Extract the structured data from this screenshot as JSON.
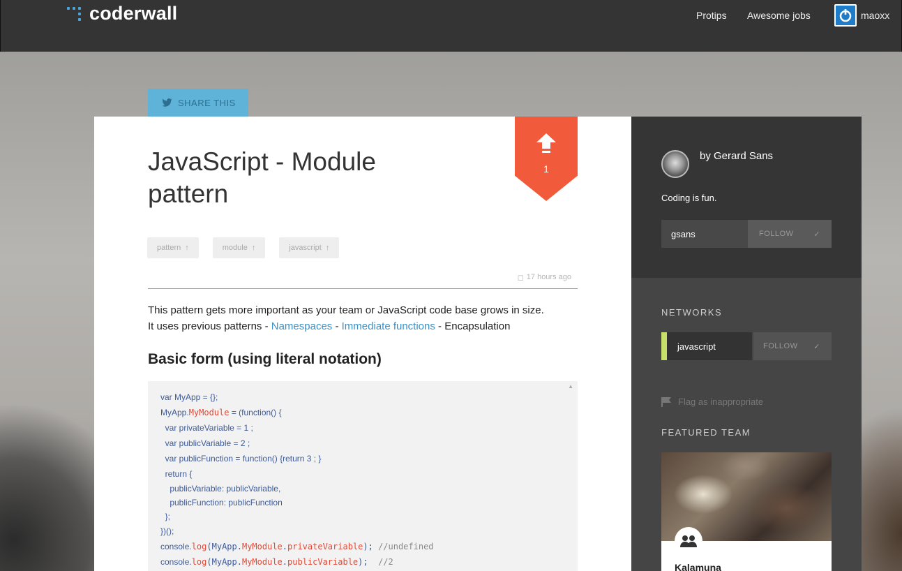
{
  "nav": {
    "logo_text": "coderwall",
    "links": [
      "Protips",
      "Awesome jobs"
    ],
    "username": "maoxx"
  },
  "share": {
    "label": "SHARE THIS"
  },
  "article": {
    "title": "JavaScript - Module pattern",
    "upvotes": "1",
    "tags": [
      "pattern",
      "module",
      "javascript"
    ],
    "timestamp": "17 hours ago",
    "intro_line1": "This pattern gets more important as your team or JavaScript code base grows in size.",
    "intro_prefix": "It uses previous patterns - ",
    "link_namespaces": "Namespaces",
    "sep1": " - ",
    "link_immediate": "Immediate functions",
    "sep2": " - ",
    "intro_suffix": "Encapsulation",
    "heading": "Basic form (using literal notation)"
  },
  "code": {
    "l1": "var MyApp = {};",
    "l2a": "MyApp.",
    "l2b": "MyModule",
    "l2c": " = (function() {",
    "l3": "  var privateVariable = 1 ;",
    "l4": "  var publicVariable = 2 ;",
    "l5": "  var publicFunction = function() {return 3 ; }",
    "l6": "  return {",
    "l7": "    publicVariable: publicVariable,",
    "l8": "    publicFunction: publicFunction",
    "l9": "  };",
    "l10": "})();",
    "l11a": "console.",
    "l11b": "log",
    "l11c": "(MyApp.",
    "l11d": "MyModule",
    "l11e": ".",
    "l11f": "privateVariable",
    "l11g": "); ",
    "l11h": "//undefined",
    "l12a": "console.",
    "l12b": "log",
    "l12c": "(MyApp.",
    "l12d": "MyModule",
    "l12e": ".",
    "l12f": "publicVariable",
    "l12g": "); ",
    "l12h": " //2"
  },
  "author": {
    "name": "by Gerard Sans",
    "bio": "Coding is fun.",
    "handle": "gsans",
    "follow_label": "FOLLOW"
  },
  "networks": {
    "label": "NETWORKS",
    "items": [
      {
        "name": "javascript",
        "follow_label": "FOLLOW"
      }
    ]
  },
  "flag_label": "Flag as inappropriate",
  "featured": {
    "label": "FEATURED TEAM",
    "team_name": "Kalamuna"
  },
  "colors": {
    "accent_blue": "#3a91c9",
    "upvote_red": "#f15a3a",
    "network_green": "#c6e06a"
  }
}
